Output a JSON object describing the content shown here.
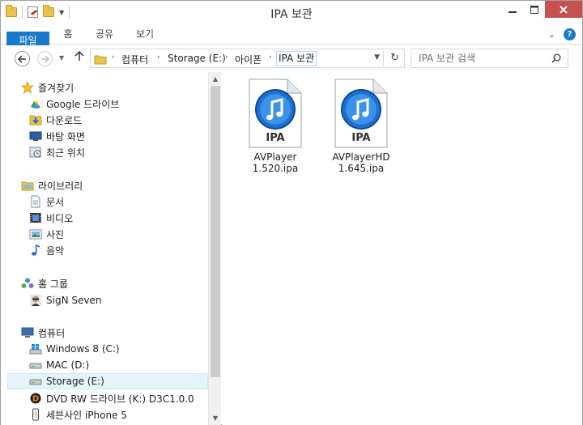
{
  "window": {
    "title": "IPA 보관"
  },
  "ribbon": {
    "tabs": [
      "파일",
      "홈",
      "공유",
      "보기"
    ],
    "help_label": "?"
  },
  "address": {
    "crumbs": [
      "컴퓨터",
      "Storage (E:)",
      "아이폰",
      "IPA 보관"
    ]
  },
  "search": {
    "placeholder": "IPA 보관 검색"
  },
  "nav": {
    "favorites": {
      "label": "즐겨찾기",
      "items": [
        "Google 드라이브",
        "다운로드",
        "바탕 화면",
        "최근 위치"
      ]
    },
    "libraries": {
      "label": "라이브러리",
      "items": [
        "문서",
        "비디오",
        "사진",
        "음악"
      ]
    },
    "homegroup": {
      "label": "홈 그룹",
      "items": [
        "SigN Seven"
      ]
    },
    "computer": {
      "label": "컴퓨터",
      "items": [
        "Windows 8 (C:)",
        "MAC (D:)",
        "Storage (E:)",
        "DVD RW 드라이브 (K:) D3C1.0.0",
        "세븐사인 iPhone 5"
      ]
    }
  },
  "files": [
    {
      "name_line1": "AVPlayer",
      "name_line2": "1.520.ipa",
      "badge": "IPA",
      "icon": "itunes-ipa-icon"
    },
    {
      "name_line1": "AVPlayerHD",
      "name_line2": "1.645.ipa",
      "badge": "IPA",
      "icon": "itunes-ipa-icon"
    }
  ],
  "colors": {
    "accent": "#1979ca",
    "close": "#c75050",
    "selection": "#e5f3fb"
  }
}
